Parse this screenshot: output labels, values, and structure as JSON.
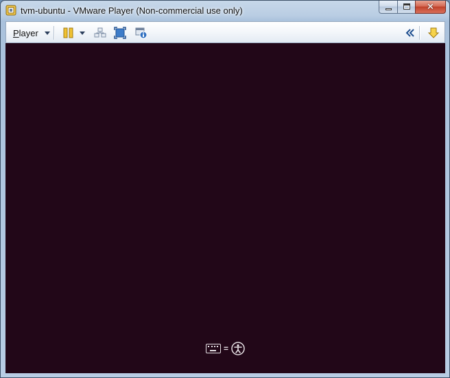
{
  "window": {
    "title": "tvm-ubuntu - VMware Player (Non-commercial use only)",
    "app_icon": "vmware-player-icon"
  },
  "caption_buttons": {
    "minimize_icon": "minimize-icon",
    "maximize_icon": "maximize-icon",
    "close_glyph": "✕"
  },
  "toolbar": {
    "player_menu_first": "P",
    "player_menu_rest": "layer",
    "icons": [
      "pause-icon",
      "pause-dropdown-arrow-icon",
      "send-ctrl-alt-del-icon",
      "full-screen-icon",
      "unity-icon",
      "collapse-toolbar-icon",
      "vmware-tools-download-icon"
    ]
  },
  "vm_screen": {
    "background": "#220718",
    "overlay_icons": [
      "keyboard-icon",
      "accessibility-person-icon"
    ],
    "equals": "="
  }
}
